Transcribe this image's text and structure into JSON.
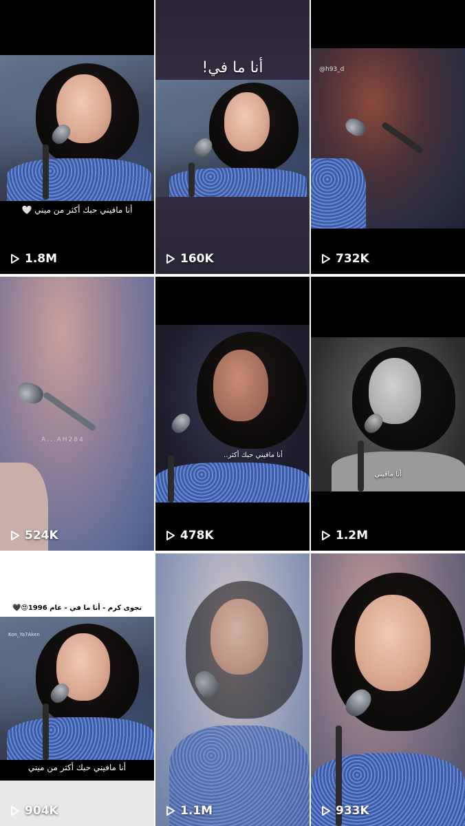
{
  "grid": {
    "tiles": [
      {
        "views": "1.8M",
        "caption": "أنا مافيني حبك أكثر من ميني 🤍"
      },
      {
        "views": "160K",
        "title": "أنا ما في!"
      },
      {
        "views": "732K",
        "handle": "@h93_d"
      },
      {
        "views": "524K",
        "watermark": "A...AH284"
      },
      {
        "views": "478K",
        "caption": "أنا مافيني حبك أكثر.."
      },
      {
        "views": "1.2M",
        "caption": "أنا مافيني"
      },
      {
        "views": "904K",
        "title": "نجوى كرم - أنا ما في - عام 1996😍🖤",
        "caption": "أنا مافيني حبك أكثر من ميني",
        "handle": "Kon_Ya7Aken"
      },
      {
        "views": "1.1M"
      },
      {
        "views": "933K"
      }
    ]
  },
  "icons": {
    "play": "play-icon"
  },
  "colors": {
    "text": "#ffffff",
    "background": "#000000",
    "dress": "#3b5aa8"
  }
}
